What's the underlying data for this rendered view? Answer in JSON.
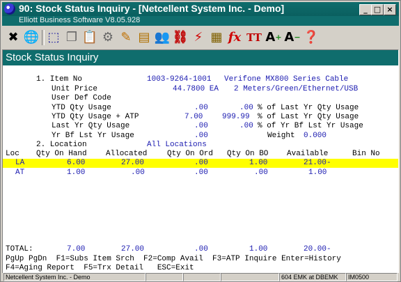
{
  "window": {
    "title": "90: Stock Status Inquiry - [Netcellent System Inc. - Demo]",
    "subtitle": "Elliott Business Software V8.05.928",
    "min": "_",
    "max": "□",
    "close": "×"
  },
  "toolbar": [
    "exit-icon",
    "globe-icon",
    "select-icon",
    "copy-icon",
    "paste-icon",
    "settings-icon",
    "edit-icon",
    "notes-icon",
    "users-icon",
    "link-icon",
    "lightning-icon",
    "calendar-icon",
    "fx-icon",
    "font-size-icon",
    "font-increase-icon",
    "font-decrease-icon",
    "help-icon"
  ],
  "screen": {
    "header": "Stock Status Inquiry",
    "item_label": "1. Item No",
    "item_no": "1003-9264-1001",
    "item_desc1": "Verifone MX800 Series Cable",
    "unit_price_label": "Unit Price",
    "unit_price": "44.7800 EA",
    "item_desc2": "2 Meters/Green/Ethernet/USB",
    "user_def_label": "User Def Code",
    "ytd_qty_label": "YTD Qty Usage",
    "ytd_qty": ".00",
    "ytd_qty_pct": ".00",
    "ytd_qty_pct_label": "% of Last Yr Qty Usage",
    "ytd_atp_label": "YTD Qty Usage + ATP",
    "ytd_atp": "7.00",
    "ytd_atp_pct": "999.99",
    "ytd_atp_pct_label": "% of Last Yr Qty Usage",
    "last_yr_label": "Last Yr Qty Usage",
    "last_yr": ".00",
    "last_yr_pct": ".00",
    "last_yr_pct_label": "% of Yr Bf Lst Yr Usage",
    "yr_bf_label": "Yr Bf Lst Yr Usage",
    "yr_bf": ".00",
    "weight_label": "Weight",
    "weight": "0.000",
    "location_label": "2. Location",
    "location_value": "All Locations",
    "columns": [
      "Loc",
      "Qty On Hand",
      "Allocated",
      "Qty On Ord",
      "Qty On BO",
      "Available",
      "Bin No"
    ],
    "rows": [
      {
        "loc": "LA",
        "on_hand": "6.00",
        "allocated": "27.00",
        "on_ord": ".00",
        "on_bo": "1.00",
        "available": "21.00-",
        "bin": ""
      },
      {
        "loc": "AT",
        "on_hand": "1.00",
        "allocated": ".00",
        "on_ord": ".00",
        "on_bo": ".00",
        "available": "1.00",
        "bin": ""
      }
    ],
    "total_label": "TOTAL:",
    "totals": {
      "on_hand": "7.00",
      "allocated": "27.00",
      "on_ord": ".00",
      "on_bo": "1.00",
      "available": "20.00-"
    },
    "help1": "PgUp PgDn  F1=Subs Item Srch  F2=Comp Avail  F3=ATP Inquire Enter=History",
    "help2": "F4=Aging Report  F5=Trx Detail   ESC=Exit"
  },
  "status": {
    "company": "Netcellent System Inc. - Demo",
    "panel2": "",
    "panel3": "",
    "panel4": "",
    "user": "604 EMK at DBEMK",
    "program": "IM0500"
  },
  "colors": {
    "title_bar": "#0f6d6d",
    "highlight": "#ffff00",
    "value_blue": "#1a1ab0"
  }
}
